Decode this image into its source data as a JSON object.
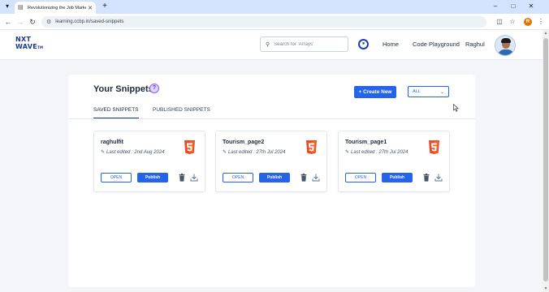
{
  "browser": {
    "tab_title": "Revolutionizing the Job Market",
    "url": "learning.ccbp.in/saved-snippets",
    "profile_initial": "R"
  },
  "header": {
    "logo_line1": "NXT",
    "logo_line2": "WAVE",
    "logo_tm": "TM",
    "search_placeholder": "Search for 'Arrays'",
    "nav": [
      "Home",
      "Code Playground",
      "Raghul"
    ]
  },
  "page": {
    "title": "Your Snippets",
    "help_label": "?",
    "create_label": "+ Create New",
    "filter_value": "ALL",
    "tabs": [
      "SAVED SNIPPETS",
      "PUBLISHED SNIPPETS"
    ],
    "active_tab": "SAVED SNIPPETS",
    "snippets": [
      {
        "name": "raghulfit",
        "edited": "Last edited : 2nd Aug 2024",
        "open_label": "OPEN",
        "publish_label": "Publish"
      },
      {
        "name": "Tourism_page2",
        "edited": "Last edited : 27th Jul 2024",
        "open_label": "OPEN",
        "publish_label": "Publish"
      },
      {
        "name": "Tourism_page1",
        "edited": "Last edited : 27th Jul 2024",
        "open_label": "OPEN",
        "publish_label": "Publish"
      }
    ]
  },
  "colors": {
    "accent": "#2563eb",
    "html5": "#e44d26",
    "html5_light": "#f16529"
  }
}
